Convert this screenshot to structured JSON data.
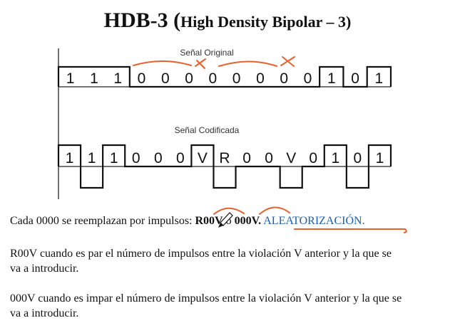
{
  "title": {
    "main": "HDB-3",
    "open_paren": " (",
    "subtitle": "High Density Bipolar – 3)"
  },
  "original_signal": {
    "caption": "Señal Original",
    "bits": [
      "1",
      "1",
      "1",
      "0",
      "0",
      "0",
      "0",
      "0",
      "0",
      "0",
      "0",
      "1",
      "0",
      "1"
    ],
    "levels": [
      1,
      1,
      1,
      0,
      0,
      0,
      0,
      0,
      0,
      0,
      0,
      1,
      0,
      1
    ]
  },
  "encoded_signal": {
    "caption": "Señal Codificada",
    "symbols": [
      "1",
      "1",
      "1",
      "0",
      "0",
      "0",
      "V",
      "R",
      "0",
      "0",
      "V",
      "0",
      "1",
      "0",
      "1"
    ],
    "levels": [
      1,
      -1,
      1,
      0,
      0,
      0,
      1,
      -1,
      0,
      0,
      -1,
      0,
      1,
      -1,
      1
    ]
  },
  "paragraphs": {
    "p1_text": "Cada 0000 se reemplazan por impulsos: ",
    "p1_r00v": "R00V",
    "p1_o": " o ",
    "p1_000v": "000V.",
    "p1_space": " ",
    "p1_aleatorizacion": "ALEATORIZACIÓN.",
    "p2_line1": "R00V cuando es par el número de impulsos entre la violación V anterior y la que se",
    "p2_line2": "va a introducir.",
    "p3_line1": "000V cuando es impar el número de impulsos entre la violación V anterior y la que se",
    "p3_line2": "va a introducir."
  },
  "colors": {
    "annotation": "#e8602a",
    "link_text": "#1a5fb4"
  },
  "icons": {
    "cursor": "pencil-cursor-icon"
  }
}
